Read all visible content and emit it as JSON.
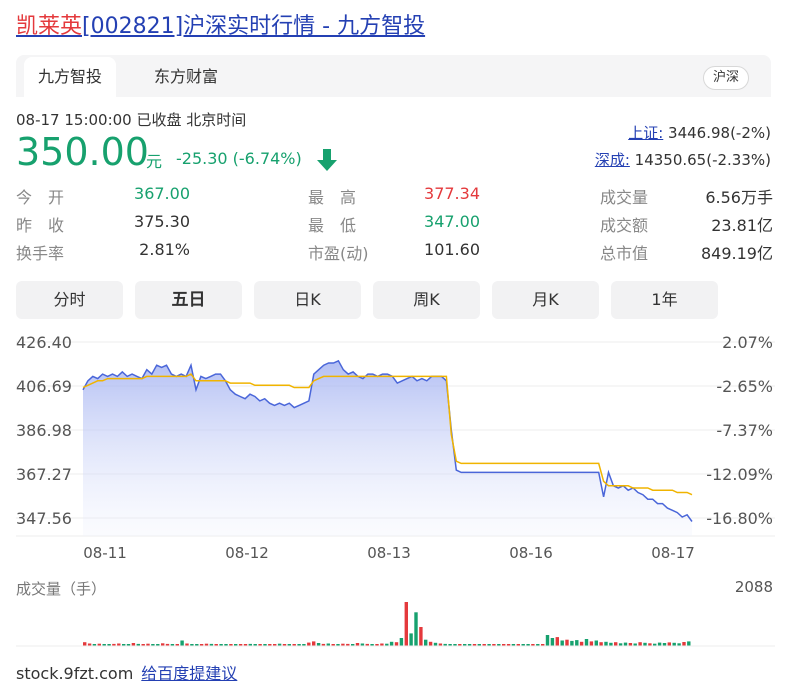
{
  "title": {
    "name": "凯莱英",
    "rest": "[002821]沪深实时行情 - 九方智投"
  },
  "tabs": [
    {
      "label": "九方智投",
      "active": true
    },
    {
      "label": "东方财富",
      "active": false
    }
  ],
  "market_badge": "沪深",
  "quote": {
    "time": "08-17 15:00:00  已收盘  北京时间",
    "price": "350.00",
    "unit": "元",
    "change": "-25.30 (-6.74%)",
    "direction": "down",
    "up_color": "#e4393c",
    "down_color": "#17a16e"
  },
  "indices": [
    {
      "name": "上证:",
      "value": "3446.98(-2%)"
    },
    {
      "name": "深成:",
      "value": "14350.65(-2.33%)"
    }
  ],
  "stats": {
    "open": {
      "label": "今　开",
      "value": "367.00"
    },
    "prev": {
      "label": "昨　收",
      "value": "375.30"
    },
    "turnover": {
      "label": "换手率",
      "value": "2.81%"
    },
    "high": {
      "label": "最　高",
      "value": "377.34"
    },
    "low": {
      "label": "最　低",
      "value": "347.00"
    },
    "pe": {
      "label": "市盈(动)",
      "value": "101.60"
    },
    "volume": {
      "label": "成交量",
      "value": "6.56万手"
    },
    "amount": {
      "label": "成交额",
      "value": "23.81亿"
    },
    "mcap": {
      "label": "总市值",
      "value": "849.19亿"
    }
  },
  "periods": [
    {
      "label": "分时",
      "active": false
    },
    {
      "label": "五日",
      "active": true
    },
    {
      "label": "日K",
      "active": false
    },
    {
      "label": "周K",
      "active": false
    },
    {
      "label": "月K",
      "active": false
    },
    {
      "label": "1年",
      "active": false
    }
  ],
  "chart_data": {
    "type": "line",
    "x_categories": [
      "08-11",
      "08-12",
      "08-13",
      "08-16",
      "08-17"
    ],
    "y_ticks": [
      "426.40",
      "406.69",
      "386.98",
      "367.27",
      "347.56"
    ],
    "y_right_ticks": [
      "2.07%",
      "-2.65%",
      "-7.37%",
      "-12.09%",
      "-16.80%"
    ],
    "ylim": [
      347.56,
      426.4
    ],
    "series": [
      {
        "role": "price",
        "color": "#4a66d9",
        "values": [
          405,
          409,
          411,
          410,
          412,
          411,
          412,
          411,
          413,
          411,
          412,
          411,
          410,
          414,
          412,
          416,
          415,
          416,
          412,
          411,
          412,
          411,
          416,
          405,
          411,
          410,
          411,
          412,
          412,
          409,
          405,
          403,
          402,
          401,
          403,
          402,
          400,
          401,
          399,
          398,
          399,
          398,
          399,
          397,
          398,
          399,
          400,
          412,
          414,
          416,
          417,
          417,
          418,
          414,
          412,
          413,
          411,
          410,
          412,
          412,
          411,
          412,
          412,
          411,
          408,
          409,
          410,
          411,
          409,
          410,
          409,
          411,
          411,
          411,
          409,
          387,
          369,
          368,
          368,
          368,
          368,
          368,
          368,
          368,
          368,
          368,
          368,
          368,
          368,
          368,
          368,
          368,
          368,
          368,
          368,
          368,
          368,
          368,
          368,
          368,
          368,
          368,
          368,
          368,
          368,
          368,
          357,
          368,
          362,
          361,
          362,
          360,
          361,
          359,
          358,
          356,
          356,
          354,
          354,
          352,
          351,
          350,
          348,
          349,
          346
        ]
      },
      {
        "role": "average",
        "color": "#f0b400",
        "values": [
          406,
          407,
          408,
          409,
          409,
          410,
          410,
          410,
          410,
          410,
          410,
          410,
          410,
          411,
          411,
          411,
          411,
          411,
          411,
          411,
          411,
          411,
          412,
          409,
          409,
          409,
          409,
          409,
          409,
          409,
          408,
          408,
          408,
          408,
          408,
          407,
          407,
          407,
          407,
          407,
          407,
          407,
          407,
          406,
          406,
          406,
          406,
          409,
          410,
          411,
          411,
          411,
          411,
          411,
          411,
          411,
          411,
          411,
          411,
          411,
          411,
          411,
          411,
          411,
          411,
          411,
          411,
          411,
          411,
          411,
          411,
          411,
          411,
          411,
          411,
          385,
          373,
          372,
          372,
          372,
          372,
          372,
          372,
          372,
          372,
          372,
          372,
          372,
          372,
          372,
          372,
          372,
          372,
          372,
          372,
          372,
          372,
          372,
          372,
          372,
          372,
          372,
          372,
          372,
          372,
          372,
          364,
          362,
          362,
          362,
          362,
          362,
          361,
          361,
          361,
          361,
          360,
          360,
          360,
          360,
          360,
          359,
          359,
          359,
          358
        ]
      }
    ],
    "volume_label": "成交量（手）",
    "volume_max": "2088",
    "volume": {
      "colors": {
        "up": "#e4393c",
        "down": "#17a16e"
      },
      "values": [
        180,
        120,
        90,
        110,
        80,
        70,
        100,
        120,
        60,
        90,
        140,
        100,
        80,
        110,
        70,
        90,
        130,
        100,
        80,
        70,
        260,
        120,
        90,
        80,
        70,
        110,
        100,
        90,
        60,
        80,
        70,
        90,
        60,
        80,
        100,
        70,
        60,
        90,
        80,
        70,
        110,
        90,
        70,
        60,
        80,
        90,
        160,
        220,
        140,
        100,
        120,
        90,
        80,
        110,
        100,
        90,
        140,
        120,
        100,
        90,
        80,
        120,
        110,
        200,
        180,
        380,
        2088,
        600,
        1600,
        900,
        300,
        200,
        150,
        120,
        100,
        80,
        90,
        60,
        70,
        50,
        60,
        40,
        50,
        60,
        40,
        50,
        70,
        60,
        40,
        50,
        60,
        70,
        50,
        40,
        60,
        520,
        380,
        420,
        260,
        300,
        240,
        280,
        200,
        330,
        220,
        260,
        180,
        200,
        150,
        180,
        130,
        160,
        140,
        120,
        180,
        150,
        130,
        110,
        160,
        140,
        170,
        150,
        130,
        190,
        220
      ],
      "dirs": [
        1,
        1,
        0,
        1,
        0,
        0,
        1,
        1,
        0,
        0,
        1,
        0,
        1,
        1,
        0,
        0,
        1,
        1,
        0,
        1,
        0,
        1,
        0,
        0,
        1,
        1,
        0,
        1,
        0,
        0,
        1,
        0,
        1,
        1,
        0,
        0,
        1,
        0,
        1,
        1,
        0,
        1,
        0,
        1,
        0,
        0,
        1,
        1,
        0,
        1,
        0,
        1,
        0,
        1,
        1,
        0,
        1,
        0,
        1,
        0,
        1,
        1,
        0,
        0,
        1,
        0,
        1,
        0,
        0,
        1,
        0,
        1,
        0,
        1,
        0,
        0,
        0,
        1,
        0,
        0,
        1,
        0,
        1,
        0,
        1,
        0,
        1,
        1,
        0,
        1,
        0,
        0,
        1,
        0,
        1,
        0,
        0,
        1,
        0,
        1,
        0,
        0,
        1,
        0,
        1,
        0,
        1,
        0,
        0,
        1,
        0,
        0,
        1,
        0,
        1,
        0,
        1,
        0,
        0,
        0,
        1,
        0,
        0,
        1
      ]
    }
  },
  "footer": {
    "site": "stock.9fzt.com",
    "feedback": "给百度提建议"
  }
}
